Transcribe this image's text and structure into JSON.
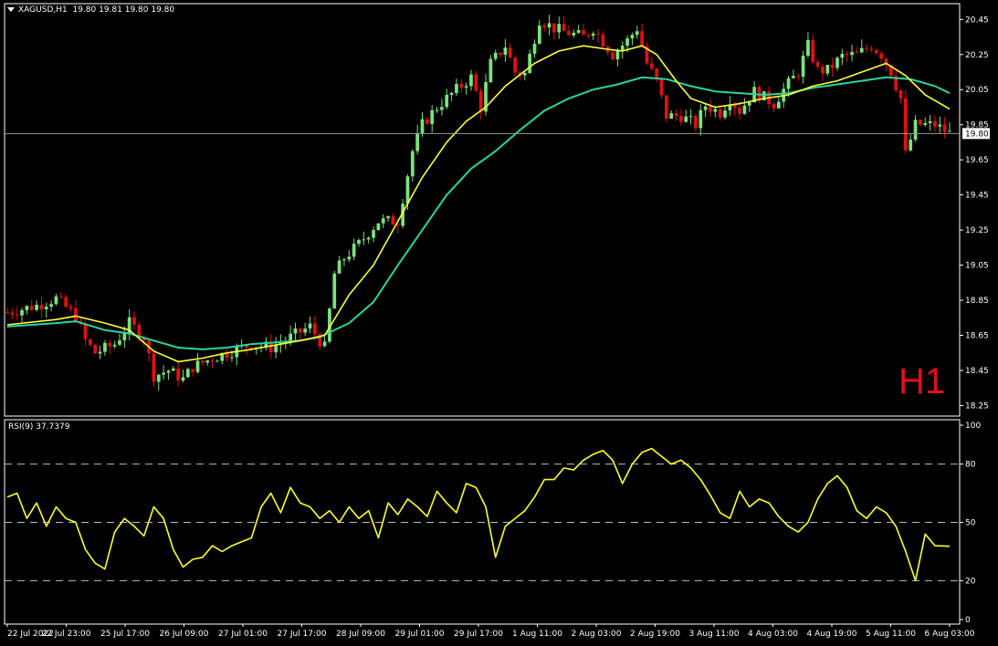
{
  "main_header": {
    "symbol_label": "XAGUSD,H1",
    "ohlc": "19.80 19.81 19.80 19.80"
  },
  "rsi_header": {
    "label": "RSI(9) 37.7379"
  },
  "timeframe_badge": "H1",
  "current_price_label": "19.80",
  "colors": {
    "background": "#000000",
    "grid": "#ffffff",
    "axis_text": "#ffffff",
    "bull_candle": "#7be27b",
    "bear_candle": "#e01010",
    "ma_fast": "#ffff33",
    "ma_slow": "#27d6a0",
    "rsi_line": "#ffff22",
    "badge": "#e0101a"
  },
  "chart_data": [
    {
      "type": "candlestick",
      "instrument": "XAGUSD",
      "timeframe": "H1",
      "ylim": [
        18.19,
        20.54
      ],
      "y_ticks": [
        "20.45",
        "20.25",
        "20.05",
        "19.85",
        "19.65",
        "19.45",
        "19.25",
        "19.05",
        "18.85",
        "18.65",
        "18.45",
        "18.25"
      ],
      "x_ticks": [
        "22 Jul 2022",
        "22 Jul 23:00",
        "25 Jul 17:00",
        "26 Jul 09:00",
        "27 Jul 01:00",
        "27 Jul 17:00",
        "28 Jul 09:00",
        "29 Jul 01:00",
        "29 Jul 17:00",
        "1 Aug 11:00",
        "2 Aug 03:00",
        "2 Aug 19:00",
        "3 Aug 11:00",
        "4 Aug 03:00",
        "4 Aug 19:00",
        "5 Aug 11:00",
        "6 Aug 03:00"
      ],
      "current_price": 19.8,
      "close_path": [
        [
          0,
          18.78
        ],
        [
          6,
          18.82
        ],
        [
          10,
          18.86
        ],
        [
          14,
          18.76
        ],
        [
          16,
          18.62
        ],
        [
          18,
          18.55
        ],
        [
          22,
          18.6
        ],
        [
          25,
          18.72
        ],
        [
          28,
          18.64
        ],
        [
          30,
          18.42
        ],
        [
          33,
          18.45
        ],
        [
          36,
          18.4
        ],
        [
          38,
          18.47
        ],
        [
          42,
          18.52
        ],
        [
          46,
          18.56
        ],
        [
          50,
          18.6
        ],
        [
          54,
          18.58
        ],
        [
          58,
          18.64
        ],
        [
          62,
          18.7
        ],
        [
          65,
          18.58
        ],
        [
          67,
          19.0
        ],
        [
          69,
          19.09
        ],
        [
          72,
          19.17
        ],
        [
          76,
          19.3
        ],
        [
          80,
          19.3
        ],
        [
          83,
          19.7
        ],
        [
          85,
          19.85
        ],
        [
          88,
          19.95
        ],
        [
          92,
          20.05
        ],
        [
          95,
          20.12
        ],
        [
          97,
          19.95
        ],
        [
          99,
          20.2
        ],
        [
          102,
          20.3
        ],
        [
          104,
          20.15
        ],
        [
          106,
          20.14
        ],
        [
          109,
          20.45
        ],
        [
          112,
          20.4
        ],
        [
          114,
          20.38
        ],
        [
          118,
          20.35
        ],
        [
          120,
          20.4
        ],
        [
          124,
          20.25
        ],
        [
          127,
          20.33
        ],
        [
          129,
          20.4
        ],
        [
          131,
          20.2
        ],
        [
          133,
          20.1
        ],
        [
          135,
          19.9
        ],
        [
          138,
          19.9
        ],
        [
          141,
          19.85
        ],
        [
          143,
          19.96
        ],
        [
          146,
          19.92
        ],
        [
          148,
          20.0
        ],
        [
          150,
          19.93
        ],
        [
          153,
          20.04
        ],
        [
          157,
          19.97
        ],
        [
          159,
          20.05
        ],
        [
          162,
          20.15
        ],
        [
          164,
          20.3
        ],
        [
          166,
          20.16
        ],
        [
          168,
          20.16
        ],
        [
          171,
          20.24
        ],
        [
          174,
          20.25
        ],
        [
          177,
          20.3
        ],
        [
          179,
          20.25
        ],
        [
          181,
          20.15
        ],
        [
          183,
          20.0
        ],
        [
          184,
          19.68
        ],
        [
          186,
          19.85
        ],
        [
          190,
          19.85
        ],
        [
          193,
          19.8
        ]
      ],
      "series": [
        {
          "name": "",
          "values": [
            [
              0,
              18.71
            ],
            [
              10,
              18.74
            ],
            [
              14,
              18.76
            ],
            [
              20,
              18.72
            ],
            [
              25,
              18.68
            ],
            [
              30,
              18.56
            ],
            [
              35,
              18.5
            ],
            [
              40,
              18.52
            ],
            [
              45,
              18.55
            ],
            [
              50,
              18.57
            ],
            [
              60,
              18.62
            ],
            [
              65,
              18.65
            ],
            [
              70,
              18.88
            ],
            [
              75,
              19.05
            ],
            [
              80,
              19.3
            ],
            [
              85,
              19.55
            ],
            [
              90,
              19.75
            ],
            [
              94,
              19.87
            ],
            [
              98,
              19.95
            ],
            [
              102,
              20.07
            ],
            [
              108,
              20.2
            ],
            [
              113,
              20.27
            ],
            [
              118,
              20.3
            ],
            [
              123,
              20.28
            ],
            [
              126,
              20.27
            ],
            [
              130,
              20.3
            ],
            [
              133,
              20.25
            ],
            [
              137,
              20.1
            ],
            [
              140,
              20.0
            ],
            [
              145,
              19.95
            ],
            [
              150,
              19.97
            ],
            [
              155,
              20.0
            ],
            [
              160,
              20.02
            ],
            [
              165,
              20.07
            ],
            [
              170,
              20.1
            ],
            [
              175,
              20.15
            ],
            [
              180,
              20.2
            ],
            [
              184,
              20.13
            ],
            [
              188,
              20.02
            ],
            [
              193,
              19.94
            ]
          ]
        },
        {
          "name": "",
          "values": [
            [
              0,
              18.7
            ],
            [
              10,
              18.72
            ],
            [
              14,
              18.73
            ],
            [
              20,
              18.68
            ],
            [
              25,
              18.66
            ],
            [
              30,
              18.62
            ],
            [
              35,
              18.58
            ],
            [
              40,
              18.57
            ],
            [
              45,
              18.58
            ],
            [
              50,
              18.6
            ],
            [
              55,
              18.61
            ],
            [
              60,
              18.62
            ],
            [
              64,
              18.64
            ],
            [
              70,
              18.72
            ],
            [
              75,
              18.84
            ],
            [
              80,
              19.05
            ],
            [
              85,
              19.25
            ],
            [
              90,
              19.45
            ],
            [
              95,
              19.6
            ],
            [
              100,
              19.7
            ],
            [
              105,
              19.82
            ],
            [
              110,
              19.93
            ],
            [
              115,
              20.0
            ],
            [
              120,
              20.05
            ],
            [
              125,
              20.08
            ],
            [
              130,
              20.12
            ],
            [
              135,
              20.11
            ],
            [
              140,
              20.07
            ],
            [
              145,
              20.04
            ],
            [
              150,
              20.03
            ],
            [
              155,
              20.02
            ],
            [
              160,
              20.03
            ],
            [
              165,
              20.06
            ],
            [
              170,
              20.08
            ],
            [
              175,
              20.1
            ],
            [
              180,
              20.12
            ],
            [
              185,
              20.11
            ],
            [
              190,
              20.07
            ],
            [
              193,
              20.03
            ]
          ]
        }
      ]
    },
    {
      "type": "line",
      "indicator": "RSI(9)",
      "ylim": [
        0,
        100
      ],
      "y_ticks": [
        100,
        80,
        50,
        20,
        0
      ],
      "levels": [
        80,
        50,
        20
      ],
      "series": [
        {
          "name": "",
          "values": [
            [
              0,
              63
            ],
            [
              2,
              65
            ],
            [
              4,
              52
            ],
            [
              6,
              60
            ],
            [
              8,
              48
            ],
            [
              10,
              58
            ],
            [
              12,
              52
            ],
            [
              14,
              50
            ],
            [
              16,
              36
            ],
            [
              18,
              29
            ],
            [
              20,
              26
            ],
            [
              22,
              45
            ],
            [
              24,
              52
            ],
            [
              26,
              48
            ],
            [
              28,
              43
            ],
            [
              30,
              58
            ],
            [
              32,
              52
            ],
            [
              34,
              36
            ],
            [
              36,
              27
            ],
            [
              38,
              31
            ],
            [
              40,
              32
            ],
            [
              42,
              38
            ],
            [
              44,
              35
            ],
            [
              46,
              38
            ],
            [
              48,
              40
            ],
            [
              50,
              42
            ],
            [
              52,
              58
            ],
            [
              54,
              65
            ],
            [
              56,
              55
            ],
            [
              58,
              68
            ],
            [
              60,
              60
            ],
            [
              62,
              58
            ],
            [
              64,
              52
            ],
            [
              66,
              56
            ],
            [
              68,
              50
            ],
            [
              70,
              58
            ],
            [
              72,
              52
            ],
            [
              74,
              56
            ],
            [
              76,
              42
            ],
            [
              78,
              60
            ],
            [
              80,
              54
            ],
            [
              82,
              62
            ],
            [
              84,
              58
            ],
            [
              86,
              53
            ],
            [
              88,
              66
            ],
            [
              90,
              60
            ],
            [
              92,
              55
            ],
            [
              94,
              70
            ],
            [
              96,
              68
            ],
            [
              98,
              58
            ],
            [
              100,
              32
            ],
            [
              102,
              48
            ],
            [
              104,
              52
            ],
            [
              106,
              56
            ],
            [
              108,
              63
            ],
            [
              110,
              72
            ],
            [
              112,
              72
            ],
            [
              114,
              78
            ],
            [
              116,
              77
            ],
            [
              118,
              82
            ],
            [
              120,
              85
            ],
            [
              122,
              87
            ],
            [
              124,
              82
            ],
            [
              126,
              70
            ],
            [
              128,
              80
            ],
            [
              130,
              86
            ],
            [
              132,
              88
            ],
            [
              134,
              84
            ],
            [
              136,
              80
            ],
            [
              138,
              82
            ],
            [
              140,
              78
            ],
            [
              142,
              72
            ],
            [
              144,
              64
            ],
            [
              146,
              55
            ],
            [
              148,
              52
            ],
            [
              150,
              66
            ],
            [
              152,
              58
            ],
            [
              154,
              62
            ],
            [
              156,
              60
            ],
            [
              158,
              53
            ],
            [
              160,
              48
            ],
            [
              162,
              45
            ],
            [
              164,
              50
            ],
            [
              166,
              62
            ],
            [
              168,
              70
            ],
            [
              170,
              74
            ],
            [
              172,
              68
            ],
            [
              174,
              56
            ],
            [
              176,
              52
            ],
            [
              178,
              58
            ],
            [
              180,
              55
            ],
            [
              182,
              48
            ],
            [
              184,
              35
            ],
            [
              186,
              20
            ],
            [
              188,
              44
            ],
            [
              190,
              38
            ],
            [
              193,
              37.7
            ]
          ]
        }
      ]
    }
  ]
}
